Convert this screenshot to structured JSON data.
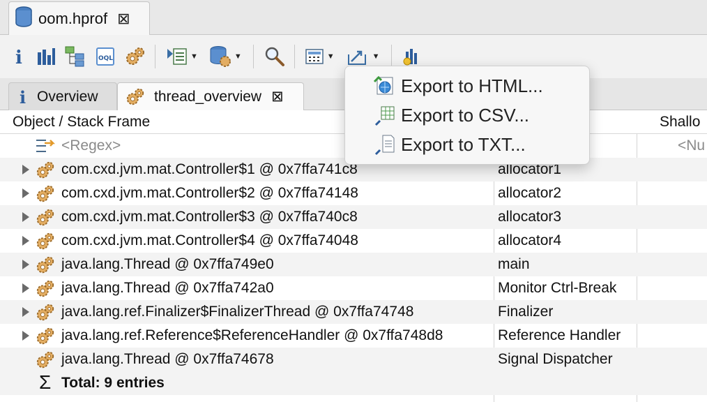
{
  "editor": {
    "tab_title": "oom.hprof"
  },
  "toolbar": {
    "buttons": [
      "info-icon",
      "histogram-icon",
      "dominator-tree-icon",
      "oql-icon",
      "thread-overview-icon",
      "layout-dropdown",
      "heap-dump-dropdown",
      "search-icon",
      "calculate-dropdown",
      "export-dropdown",
      "leak-suspects-icon"
    ]
  },
  "view_tabs": {
    "overview": "Overview",
    "thread_overview": "thread_overview"
  },
  "table": {
    "headers": {
      "object": "Object / Stack Frame",
      "shallow": "Shallo"
    },
    "regex_row": {
      "object": "<Regex>",
      "shallow": "<Nu"
    },
    "rows": [
      {
        "object": "com.cxd.jvm.mat.Controller$1 @ 0x7ffa741c8",
        "name": "allocator1",
        "expandable": true
      },
      {
        "object": "com.cxd.jvm.mat.Controller$2 @ 0x7ffa74148",
        "name": "allocator2",
        "expandable": true
      },
      {
        "object": "com.cxd.jvm.mat.Controller$3 @ 0x7ffa740c8",
        "name": "allocator3",
        "expandable": true
      },
      {
        "object": "com.cxd.jvm.mat.Controller$4 @ 0x7ffa74048",
        "name": "allocator4",
        "expandable": true
      },
      {
        "object": "java.lang.Thread @ 0x7ffa749e0",
        "name": "main",
        "expandable": true
      },
      {
        "object": "java.lang.Thread @ 0x7ffa742a0",
        "name": "Monitor Ctrl-Break",
        "expandable": true
      },
      {
        "object": "java.lang.ref.Finalizer$FinalizerThread @ 0x7ffa74748",
        "name": "Finalizer",
        "expandable": true
      },
      {
        "object": "java.lang.ref.Reference$ReferenceHandler @ 0x7ffa748d8",
        "name": "Reference Handler",
        "expandable": true
      },
      {
        "object": "java.lang.Thread @ 0x7ffa74678",
        "name": "Signal Dispatcher",
        "expandable": false
      }
    ],
    "total": "Total: 9 entries"
  },
  "menu": {
    "items": [
      {
        "label": "Export to HTML...",
        "icon": "html-export-icon"
      },
      {
        "label": "Export to CSV...",
        "icon": "csv-export-icon"
      },
      {
        "label": "Export to TXT...",
        "icon": "txt-export-icon"
      }
    ]
  },
  "colors": {
    "accent": "#3a6ea5",
    "gear": "#d9a05a",
    "alt_row": "#f3f3f3"
  }
}
